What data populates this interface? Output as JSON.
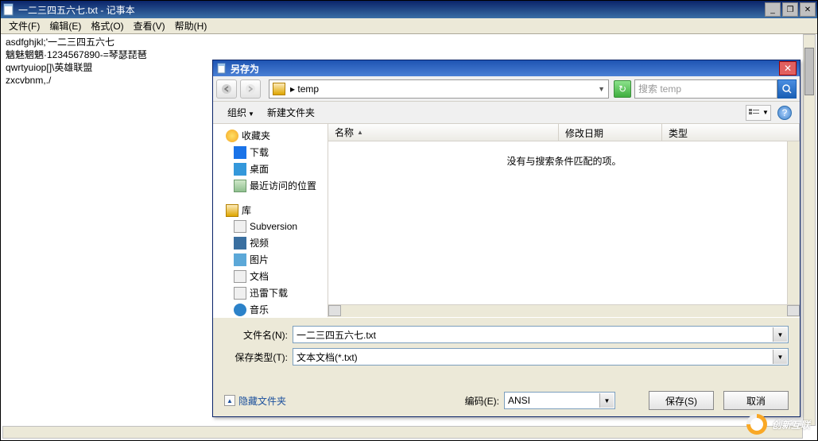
{
  "notepad": {
    "title": "一二三四五六七.txt - 记事本",
    "menus": {
      "file": "文件(F)",
      "edit": "编辑(E)",
      "format": "格式(O)",
      "view": "查看(V)",
      "help": "帮助(H)"
    },
    "content": "asdfghjkl;'一二三四五六七\n魑魅魍魉·1234567890-=琴瑟琵琶\nqwrtyuiop[]\\英雄联盟\nzxcvbnm,./"
  },
  "dialog": {
    "title": "另存为",
    "location_path": "▸ temp",
    "search_placeholder": "搜索 temp",
    "toolbar": {
      "organize": "组织",
      "new_folder": "新建文件夹"
    },
    "sidebar": {
      "favorites": {
        "label": "收藏夹",
        "items": [
          {
            "id": "downloads",
            "label": "下载"
          },
          {
            "id": "desktop",
            "label": "桌面"
          },
          {
            "id": "recent",
            "label": "最近访问的位置"
          }
        ]
      },
      "libraries": {
        "label": "库",
        "items": [
          {
            "id": "svn",
            "label": "Subversion"
          },
          {
            "id": "video",
            "label": "视频"
          },
          {
            "id": "pics",
            "label": "图片"
          },
          {
            "id": "docs",
            "label": "文档"
          },
          {
            "id": "xunlei",
            "label": "迅雷下载"
          },
          {
            "id": "music",
            "label": "音乐"
          }
        ]
      }
    },
    "columns": {
      "name": "名称",
      "date": "修改日期",
      "type": "类型"
    },
    "empty_message": "没有与搜索条件匹配的项。",
    "filename_label": "文件名(N):",
    "filetype_label": "保存类型(T):",
    "filename_value": "一二三四五六七.txt",
    "filetype_value": "文本文档(*.txt)",
    "hide_folders": "隐藏文件夹",
    "encoding_label": "编码(E):",
    "encoding_value": "ANSI",
    "save_btn": "保存(S)",
    "cancel_btn": "取消"
  },
  "watermark": "创新互联"
}
